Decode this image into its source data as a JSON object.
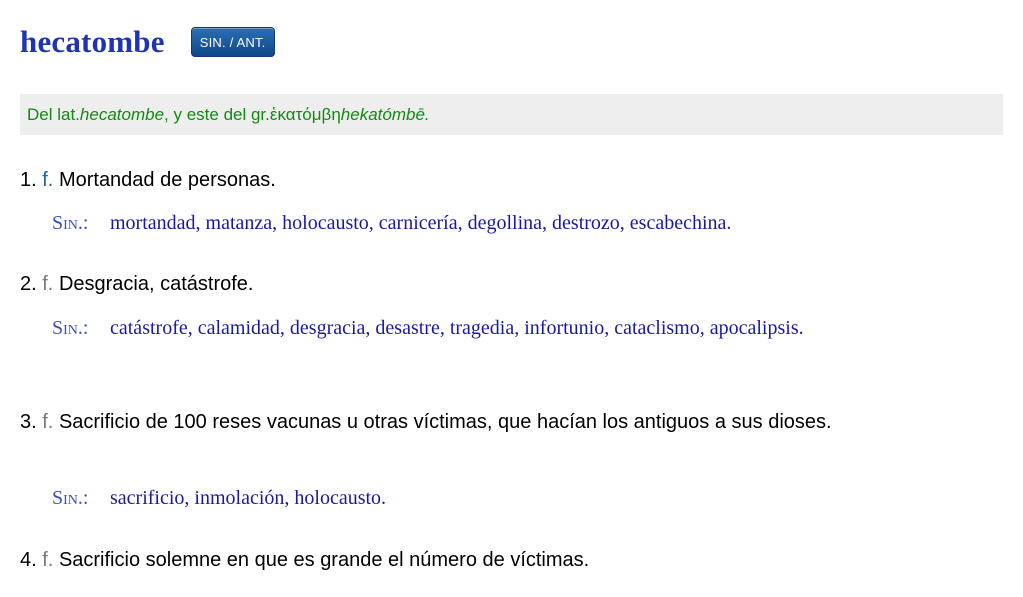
{
  "entry": {
    "headword": "hecatombe",
    "sinant_label": "SIN. / ANT."
  },
  "etymology": {
    "prefix": "Del lat. ",
    "latin": "hecatombe",
    "middle": ", y este del gr. ",
    "greek": "ἑκατόμβη",
    "space": " ",
    "translit": "hekatómbē."
  },
  "senses": [
    {
      "number": "1.",
      "abbr": "f.",
      "text": "Mortandad de personas.",
      "syn_label": "Sin.:",
      "synonyms": "mortandad, matanza, holocausto, carnicería, degollina, destrozo, escabechina."
    },
    {
      "number": "2.",
      "abbr": "f.",
      "text": "Desgracia, catástrofe.",
      "syn_label": "Sin.:",
      "synonyms": "catástrofe, calamidad, desgracia, desastre, tragedia, infortunio, cataclismo, apocalipsis."
    },
    {
      "number": "3.",
      "abbr": "f.",
      "text": "Sacrificio de 100 reses vacunas u otras víctimas, que hacían los antiguos a sus dioses.",
      "syn_label": "Sin.:",
      "synonyms": "sacrificio, inmolación, holocausto."
    },
    {
      "number": "4.",
      "abbr": "f.",
      "text": "Sacrificio solemne en que es grande el número de víctimas."
    }
  ],
  "colors": {
    "headword": "#1d34b3",
    "etymology": "#128a12",
    "synonyms": "#1a1a9c",
    "button": "#1a5a9e"
  }
}
